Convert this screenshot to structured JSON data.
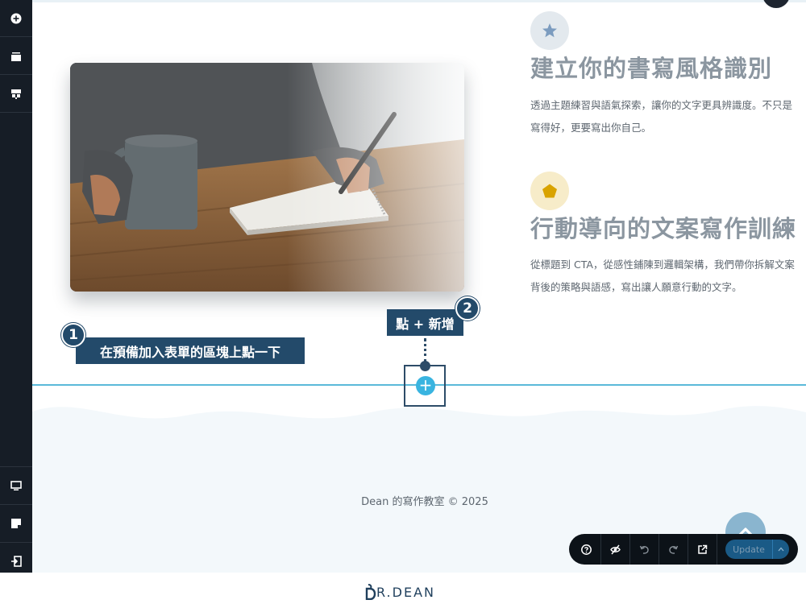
{
  "sidebar": {
    "top_items": [
      {
        "icon": "add-circle-icon"
      },
      {
        "icon": "layers-icon"
      },
      {
        "icon": "layout-icon"
      }
    ],
    "bottom_items": [
      {
        "icon": "desktop-icon"
      },
      {
        "icon": "note-icon"
      },
      {
        "icon": "exit-icon"
      }
    ]
  },
  "features": [
    {
      "icon": "star-icon",
      "title": "建立你的書寫風格識別",
      "text": "透過主題練習與語氣探索，讓你的文字更具辨識度。不只是寫得好，更要寫出你自己。"
    },
    {
      "icon": "pentagon-icon",
      "title": "行動導向的文案寫作訓練",
      "text": "從標題到 CTA，從感性鋪陳到邏輯架構，我們帶你拆解文案背後的策略與語感，寫出讓人願意行動的文字。"
    }
  ],
  "callouts": {
    "step1_number": "1",
    "step1_text": "在預備加入表單的區塊上點一下",
    "step2_number": "2",
    "step2_text": "點 + 新增"
  },
  "add_button_label": "+",
  "footer": {
    "copyright": "Dean 的寫作教室 © 2025"
  },
  "toolbar": {
    "update_label": "Update"
  },
  "brand": {
    "name": "R.DEAN"
  },
  "colors": {
    "sidebar_bg": "#161d26",
    "accent_blue": "#39b4e0",
    "callout_bg": "#234a6a",
    "title_gray": "#8b96a0",
    "footer_bg": "#f3f8fb"
  }
}
